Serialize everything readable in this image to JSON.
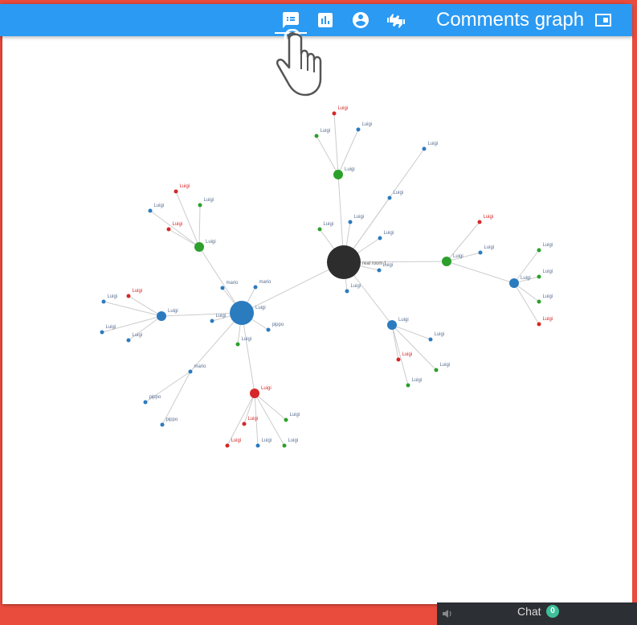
{
  "header": {
    "title": "Comments graph"
  },
  "toolbar_icons": [
    {
      "name": "comments-list-icon",
      "icon": "comments-list-icon"
    },
    {
      "name": "bar-chart-icon",
      "icon": "bar-chart-icon"
    },
    {
      "name": "account-icon",
      "icon": "account-icon"
    },
    {
      "name": "thumbs-icon",
      "icon": "thumbs-icon"
    }
  ],
  "chat": {
    "label": "Chat",
    "count": "0"
  },
  "colors": {
    "blue": "#2b7bbf",
    "green": "#2ca02c",
    "red": "#d62728",
    "black": "#2d2d2d",
    "edge": "#cccccc",
    "header": "#2b9af3"
  },
  "graph": {
    "nodes": [
      {
        "id": "root",
        "label": "real room 1",
        "color": "black",
        "size": "xl"
      },
      {
        "id": "g1",
        "label": "Luigi",
        "color": "green",
        "size": "m"
      },
      {
        "id": "g1a",
        "label": "Luigi",
        "color": "red",
        "size": "s"
      },
      {
        "id": "g1b",
        "label": "Luigi",
        "color": "green",
        "size": "s"
      },
      {
        "id": "g1c",
        "label": "Luigi",
        "color": "blue",
        "size": "s"
      },
      {
        "id": "r1",
        "label": "Luigi",
        "color": "blue",
        "size": "s"
      },
      {
        "id": "r2",
        "label": "Luigi",
        "color": "blue",
        "size": "s"
      },
      {
        "id": "r3",
        "label": "Luigi",
        "color": "blue",
        "size": "s"
      },
      {
        "id": "r4",
        "label": "Luigi",
        "color": "green",
        "size": "s"
      },
      {
        "id": "r5",
        "label": "Luigi",
        "color": "blue",
        "size": "s"
      },
      {
        "id": "r6",
        "label": "Luigi",
        "color": "blue",
        "size": "s"
      },
      {
        "id": "r7",
        "label": "Luigi",
        "color": "blue",
        "size": "s"
      },
      {
        "id": "g2",
        "label": "Luigi",
        "color": "green",
        "size": "m"
      },
      {
        "id": "g2a",
        "label": "Luigi",
        "color": "red",
        "size": "s"
      },
      {
        "id": "g2b",
        "label": "Luigi",
        "color": "blue",
        "size": "s"
      },
      {
        "id": "b2",
        "label": "Luigi",
        "color": "blue",
        "size": "m"
      },
      {
        "id": "b2a",
        "label": "Luigi",
        "color": "green",
        "size": "s"
      },
      {
        "id": "b2b",
        "label": "Luigi",
        "color": "green",
        "size": "s"
      },
      {
        "id": "b2c",
        "label": "Luigi",
        "color": "green",
        "size": "s"
      },
      {
        "id": "b2d",
        "label": "Luigi",
        "color": "red",
        "size": "s"
      },
      {
        "id": "b3",
        "label": "Luigi",
        "color": "blue",
        "size": "m"
      },
      {
        "id": "b3a",
        "label": "Luigi",
        "color": "blue",
        "size": "s"
      },
      {
        "id": "b3b",
        "label": "Luigi",
        "color": "red",
        "size": "s"
      },
      {
        "id": "b3c",
        "label": "Luigi",
        "color": "green",
        "size": "s"
      },
      {
        "id": "b3d",
        "label": "Luigi",
        "color": "green",
        "size": "s"
      },
      {
        "id": "B",
        "label": "Luigi",
        "color": "blue",
        "size": "l"
      },
      {
        "id": "Bm1",
        "label": "mario",
        "color": "blue",
        "size": "s"
      },
      {
        "id": "Bm2",
        "label": "mario",
        "color": "blue",
        "size": "s"
      },
      {
        "id": "Bp",
        "label": "pippo",
        "color": "blue",
        "size": "s"
      },
      {
        "id": "Bg",
        "label": "Luigi",
        "color": "green",
        "size": "s"
      },
      {
        "id": "Bl",
        "label": "Luigi",
        "color": "blue",
        "size": "s"
      },
      {
        "id": "g3",
        "label": "Luigi",
        "color": "green",
        "size": "m"
      },
      {
        "id": "g3a",
        "label": "Luigi",
        "color": "red",
        "size": "s"
      },
      {
        "id": "g3b",
        "label": "Luigi",
        "color": "green",
        "size": "s"
      },
      {
        "id": "g3c",
        "label": "Luigi",
        "color": "blue",
        "size": "s"
      },
      {
        "id": "g3d",
        "label": "Luigi",
        "color": "red",
        "size": "s"
      },
      {
        "id": "b4",
        "label": "Luigi",
        "color": "blue",
        "size": "m"
      },
      {
        "id": "b4a",
        "label": "Luigi",
        "color": "blue",
        "size": "s"
      },
      {
        "id": "b4b",
        "label": "Luigi",
        "color": "red",
        "size": "s"
      },
      {
        "id": "b4c",
        "label": "Luigi",
        "color": "blue",
        "size": "s"
      },
      {
        "id": "b4d",
        "label": "Luigi",
        "color": "blue",
        "size": "s"
      },
      {
        "id": "m3",
        "label": "mario",
        "color": "blue",
        "size": "s"
      },
      {
        "id": "m3a",
        "label": "pippo",
        "color": "blue",
        "size": "s"
      },
      {
        "id": "m3b",
        "label": "pippo",
        "color": "blue",
        "size": "s"
      },
      {
        "id": "r8",
        "label": "Luigi",
        "color": "red",
        "size": "m"
      },
      {
        "id": "r8a",
        "label": "Luigi",
        "color": "red",
        "size": "s"
      },
      {
        "id": "r8b",
        "label": "Luigi",
        "color": "red",
        "size": "s"
      },
      {
        "id": "r8c",
        "label": "Luigi",
        "color": "blue",
        "size": "s"
      },
      {
        "id": "r8d",
        "label": "Luigi",
        "color": "green",
        "size": "s"
      },
      {
        "id": "r8e",
        "label": "Luigi",
        "color": "green",
        "size": "s"
      }
    ],
    "edges": [
      [
        "root",
        "g1"
      ],
      [
        "g1",
        "g1a"
      ],
      [
        "g1",
        "g1b"
      ],
      [
        "g1",
        "g1c"
      ],
      [
        "root",
        "r1"
      ],
      [
        "root",
        "r2"
      ],
      [
        "root",
        "r3"
      ],
      [
        "root",
        "r4"
      ],
      [
        "root",
        "r5"
      ],
      [
        "root",
        "r6"
      ],
      [
        "root",
        "r7"
      ],
      [
        "root",
        "g2"
      ],
      [
        "g2",
        "g2a"
      ],
      [
        "g2",
        "g2b"
      ],
      [
        "g2",
        "b2"
      ],
      [
        "b2",
        "b2a"
      ],
      [
        "b2",
        "b2b"
      ],
      [
        "b2",
        "b2c"
      ],
      [
        "b2",
        "b2d"
      ],
      [
        "root",
        "b3"
      ],
      [
        "b3",
        "b3a"
      ],
      [
        "b3",
        "b3b"
      ],
      [
        "b3",
        "b3c"
      ],
      [
        "b3",
        "b3d"
      ],
      [
        "root",
        "B"
      ],
      [
        "B",
        "Bm1"
      ],
      [
        "B",
        "Bm2"
      ],
      [
        "B",
        "Bp"
      ],
      [
        "B",
        "Bg"
      ],
      [
        "B",
        "Bl"
      ],
      [
        "B",
        "g3"
      ],
      [
        "g3",
        "g3a"
      ],
      [
        "g3",
        "g3b"
      ],
      [
        "g3",
        "g3c"
      ],
      [
        "g3",
        "g3d"
      ],
      [
        "B",
        "b4"
      ],
      [
        "b4",
        "b4a"
      ],
      [
        "b4",
        "b4b"
      ],
      [
        "b4",
        "b4c"
      ],
      [
        "b4",
        "b4d"
      ],
      [
        "B",
        "m3"
      ],
      [
        "m3",
        "m3a"
      ],
      [
        "m3",
        "m3b"
      ],
      [
        "B",
        "r8"
      ],
      [
        "r8",
        "r8a"
      ],
      [
        "r8",
        "r8b"
      ],
      [
        "r8",
        "r8c"
      ],
      [
        "r8",
        "r8d"
      ],
      [
        "r8",
        "r8e"
      ]
    ]
  }
}
